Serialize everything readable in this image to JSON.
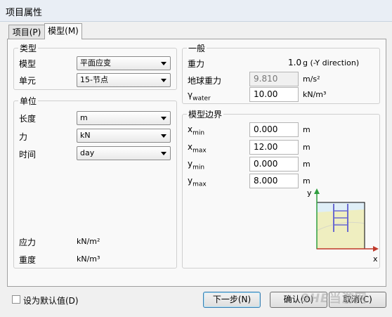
{
  "window": {
    "title": "项目属性"
  },
  "tabs": [
    {
      "label": "项目(P)"
    },
    {
      "label": "模型(M)"
    }
  ],
  "type_group": {
    "legend": "类型",
    "model_label": "模型",
    "model_value": "平面应变",
    "element_label": "单元",
    "element_value": "15-节点"
  },
  "units_group": {
    "legend": "单位",
    "length_label": "长度",
    "length_value": "m",
    "force_label": "力",
    "force_value": "kN",
    "time_label": "时间",
    "time_value": "day",
    "stress_label": "应力",
    "stress_value": "kN/m²",
    "weight_label": "重度",
    "weight_value": "kN/m³"
  },
  "general_group": {
    "legend": "一般",
    "gravity_label": "重力",
    "gravity_value": "1.0",
    "gravity_unit": "g (-Y direction)",
    "earth_gravity_label": "地球重力",
    "earth_gravity_value": "9.810",
    "earth_gravity_unit": "m/s²",
    "gamma_symbol": "γ",
    "gamma_sub": "water",
    "gamma_value": "10.00",
    "gamma_unit": "kN/m³"
  },
  "bounds_group": {
    "legend": "模型边界",
    "xmin": {
      "base": "x",
      "sub": "min",
      "value": "0.000",
      "unit": "m"
    },
    "xmax": {
      "base": "x",
      "sub": "max",
      "value": "12.00",
      "unit": "m"
    },
    "ymin": {
      "base": "y",
      "sub": "min",
      "value": "0.000",
      "unit": "m"
    },
    "ymax": {
      "base": "y",
      "sub": "max",
      "value": "8.000",
      "unit": "m"
    },
    "axis_y": "y",
    "axis_x": "x"
  },
  "footer": {
    "default_checkbox_label": "设为默认值(D)",
    "next_button": "下一步(N)",
    "ok_button": "确认(O)",
    "cancel_button": "取消(C)",
    "watermark": "当游网"
  },
  "colors": {
    "axis_green": "#2f9e3f",
    "axis_red": "#c0392b",
    "sky": "#dfeef7",
    "soil": "#efeec0"
  }
}
